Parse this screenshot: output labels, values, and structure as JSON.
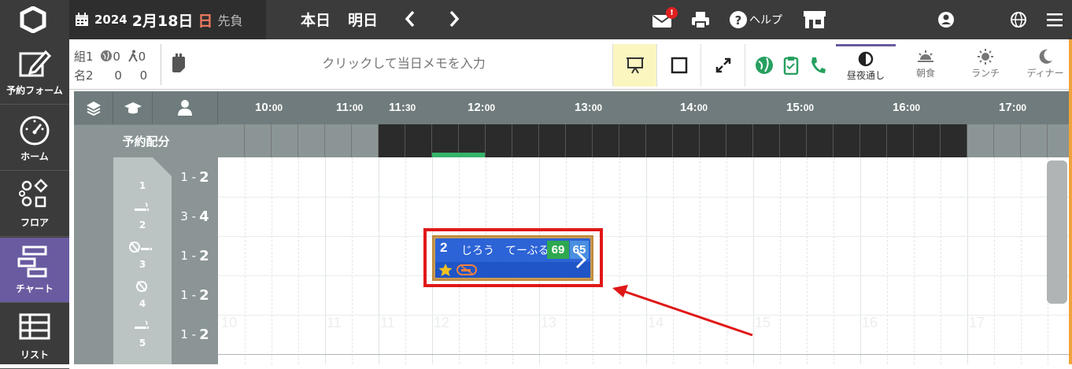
{
  "header": {
    "year": "2024",
    "month_day": "2月18日",
    "weekday": "日",
    "rokuyo": "先負",
    "today_label": "本日",
    "tomorrow_label": "明日",
    "mail_badge": "!",
    "help_label": "ヘルプ"
  },
  "sidebar": {
    "items": [
      {
        "label": "予約フォーム",
        "icon": "edit-icon"
      },
      {
        "label": "ホーム",
        "icon": "dashboard-icon"
      },
      {
        "label": "フロア",
        "icon": "shapes-icon"
      },
      {
        "label": "チャート",
        "icon": "chart-icon"
      },
      {
        "label": "リスト",
        "icon": "table-icon"
      }
    ]
  },
  "toolbar": {
    "row1_label": "組",
    "row1_total": "1",
    "row1_web": "0",
    "row1_walk": "0",
    "row2_label": "名",
    "row2_total": "2",
    "row2_web": "0",
    "row2_walk": "0",
    "memo_placeholder": "クリックして当日メモを入力",
    "modes": [
      {
        "label": "昼夜通し",
        "icon": "half-circle-icon"
      },
      {
        "label": "朝食",
        "icon": "sunrise-icon"
      },
      {
        "label": "ランチ",
        "icon": "sun-icon"
      },
      {
        "label": "ディナー",
        "icon": "moon-icon"
      }
    ]
  },
  "chart": {
    "alloc_label": "予約配分",
    "times": [
      {
        "h": "10:",
        "m": "00"
      },
      {
        "h": "11:",
        "m": "00"
      },
      {
        "h": "11:",
        "m": "30"
      },
      {
        "h": "12:",
        "m": "00"
      },
      {
        "h": "13:",
        "m": "00"
      },
      {
        "h": "14:",
        "m": "00"
      },
      {
        "h": "15:",
        "m": "00"
      },
      {
        "h": "16:",
        "m": "00"
      },
      {
        "h": "17:",
        "m": "00"
      }
    ],
    "watermarks": [
      "10",
      "11",
      "11",
      "12",
      "13",
      "14",
      "15",
      "16",
      "17"
    ],
    "tables": [
      {
        "name": "1",
        "cap_min": "1 -",
        "cap_max": "2"
      },
      {
        "name": "2",
        "cap_min": "3 -",
        "cap_max": "4"
      },
      {
        "name": "3",
        "cap_min": "1 -",
        "cap_max": "2"
      },
      {
        "name": "4",
        "cap_min": "1 -",
        "cap_max": "2"
      },
      {
        "name": "5",
        "cap_min": "1 -",
        "cap_max": "2"
      }
    ]
  },
  "reservation": {
    "party": "2",
    "name": "じろう　てーぶる",
    "badge1": "69",
    "badge2": "65"
  }
}
